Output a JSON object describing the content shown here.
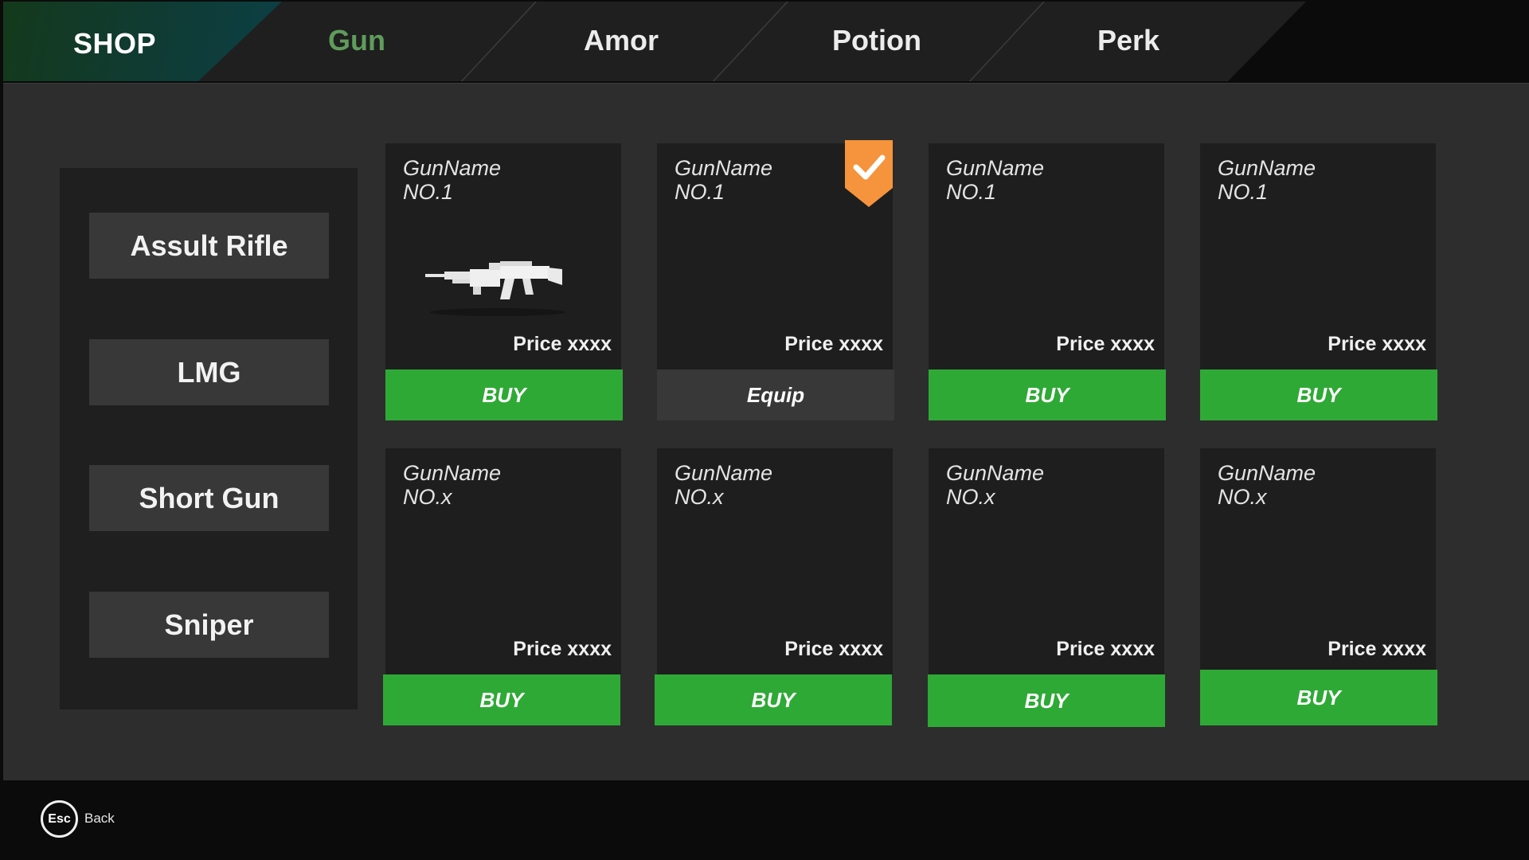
{
  "header": {
    "shop_label": "SHOP",
    "tabs": [
      {
        "label": "Gun",
        "active": true
      },
      {
        "label": "Amor",
        "active": false
      },
      {
        "label": "Potion",
        "active": false
      },
      {
        "label": "Perk",
        "active": false
      }
    ]
  },
  "categories": [
    {
      "label": "Assult Rifle"
    },
    {
      "label": "LMG"
    },
    {
      "label": "Short Gun"
    },
    {
      "label": "Sniper"
    }
  ],
  "items": [
    {
      "name": "GunName",
      "number": "NO.1",
      "price": "Price xxxx",
      "action": "BUY",
      "equipped": false,
      "image": "assault-rifle-image"
    },
    {
      "name": "GunName",
      "number": "NO.1",
      "price": "Price xxxx",
      "action": "Equip",
      "equipped": true
    },
    {
      "name": "GunName",
      "number": "NO.1",
      "price": "Price xxxx",
      "action": "BUY",
      "equipped": false
    },
    {
      "name": "GunName",
      "number": "NO.1",
      "price": "Price xxxx",
      "action": "BUY",
      "equipped": false
    },
    {
      "name": "GunName",
      "number": "NO.x",
      "price": "Price xxxx",
      "action": "BUY",
      "equipped": false
    },
    {
      "name": "GunName",
      "number": "NO.x",
      "price": "Price xxxx",
      "action": "BUY",
      "equipped": false
    },
    {
      "name": "GunName",
      "number": "NO.x",
      "price": "Price xxxx",
      "action": "BUY",
      "equipped": false
    },
    {
      "name": "GunName",
      "number": "NO.x",
      "price": "Price xxxx",
      "action": "BUY",
      "equipped": false
    }
  ],
  "footer": {
    "key_label": "Esc",
    "back_label": "Back"
  },
  "colors": {
    "active_tab": "#5f9c5b",
    "buy_button": "#2fa936",
    "equip_button": "#383838",
    "equipped_badge": "#f5943c",
    "shop_tab": "#0f3b33"
  }
}
